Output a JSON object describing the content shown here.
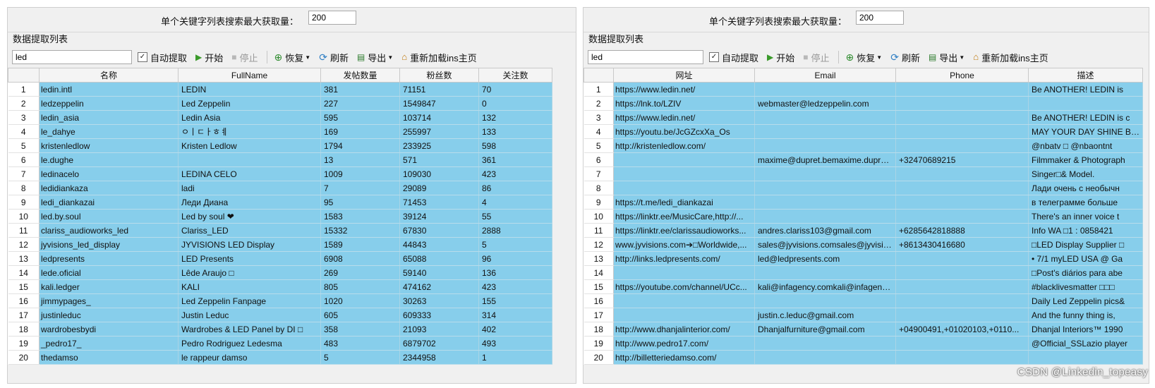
{
  "left": {
    "limit_label": "单个关键字列表搜索最大获取量：",
    "limit_value": "200",
    "section_title": "数据提取列表",
    "toolbar": {
      "keyword": "led",
      "auto_extract": "自动提取",
      "start": "开始",
      "stop": "停止",
      "restore": "恢复",
      "refresh": "刷新",
      "export": "导出",
      "reload": "重新加载ins主页"
    },
    "columns": [
      "名称",
      "FullName",
      "发帖数量",
      "粉丝数",
      "关注数"
    ],
    "rows": [
      [
        "1",
        "ledin.intl",
        "LEDIN",
        "381",
        "71151",
        "70"
      ],
      [
        "2",
        "ledzeppelin",
        "Led Zeppelin",
        "227",
        "1549847",
        "0"
      ],
      [
        "3",
        "ledin_asia",
        "Ledin Asia",
        "595",
        "103714",
        "132"
      ],
      [
        "4",
        "le_dahye",
        "ㅇㅣㄷㅏㅎㅖ",
        "169",
        "255997",
        "133"
      ],
      [
        "5",
        "kristenledlow",
        "Kristen Ledlow",
        "1794",
        "233925",
        "598"
      ],
      [
        "6",
        "le.dughe",
        "",
        "13",
        "571",
        "361"
      ],
      [
        "7",
        "ledinacelo",
        "LEDINA CELO",
        "1009",
        "109030",
        "423"
      ],
      [
        "8",
        "ledidiankaza",
        "ladi",
        "7",
        "29089",
        "86"
      ],
      [
        "9",
        "ledi_diankazai",
        "Леди Диана",
        "95",
        "71453",
        "4"
      ],
      [
        "10",
        "led.by.soul",
        "Led by soul ❤",
        "1583",
        "39124",
        "55"
      ],
      [
        "11",
        "clariss_audioworks_led",
        "Clariss_LED",
        "15332",
        "67830",
        "2888"
      ],
      [
        "12",
        "jyvisions_led_display",
        "JYVISIONS LED Display",
        "1589",
        "44843",
        "5"
      ],
      [
        "13",
        "ledpresents",
        "LED Presents",
        "6908",
        "65088",
        "96"
      ],
      [
        "14",
        "lede.oficial",
        "Lêde Araujo □",
        "269",
        "59140",
        "136"
      ],
      [
        "15",
        "kali.ledger",
        "KALI",
        "805",
        "474162",
        "423"
      ],
      [
        "16",
        "jimmypages_",
        "Led Zeppelin Fanpage",
        "1020",
        "30263",
        "155"
      ],
      [
        "17",
        "justinleduc",
        "Justin Leduc",
        "605",
        "609333",
        "314"
      ],
      [
        "18",
        "wardrobesbydi",
        "Wardrobes & LED Panel by DI □",
        "358",
        "21093",
        "402"
      ],
      [
        "19",
        "_pedro17_",
        "Pedro Rodriguez Ledesma",
        "483",
        "6879702",
        "493"
      ],
      [
        "20",
        "thedamso",
        "le rappeur damso",
        "5",
        "2344958",
        "1"
      ]
    ]
  },
  "right": {
    "limit_label": "单个关键字列表搜索最大获取量：",
    "limit_value": "200",
    "section_title": "数据提取列表",
    "toolbar": {
      "keyword": "led",
      "auto_extract": "自动提取",
      "start": "开始",
      "stop": "停止",
      "restore": "恢复",
      "refresh": "刷新",
      "export": "导出",
      "reload": "重新加载ins主页"
    },
    "columns": [
      "网址",
      "Email",
      "Phone",
      "描述"
    ],
    "rows": [
      [
        "1",
        "https://www.ledin.net/",
        "",
        "",
        "Be ANOTHER! LEDIN is"
      ],
      [
        "2",
        "https://lnk.to/LZIV",
        "webmaster@ledzeppelin.com",
        "",
        ""
      ],
      [
        "3",
        "https://www.ledin.net/",
        "",
        "",
        "Be ANOTHER! LEDIN is c"
      ],
      [
        "4",
        "https://youtu.be/JcGZcxXa_Os",
        "",
        "",
        "MAY YOUR DAY SHINE BRIG"
      ],
      [
        "5",
        "http://kristenledlow.com/",
        "",
        "",
        "@nbatv □ @nbaontnt"
      ],
      [
        "6",
        "",
        "maxime@dupret.bemaxime.dupret...",
        "+32470689215",
        "Filmmaker & Photograph"
      ],
      [
        "7",
        "",
        "",
        "",
        "Singer□& Model."
      ],
      [
        "8",
        "",
        "",
        "",
        "Лади очень с необычн"
      ],
      [
        "9",
        "https://t.me/ledi_diankazai",
        "",
        "",
        "в телеграмме больше"
      ],
      [
        "10",
        "https://linktr.ee/MusicCare,http://...",
        "",
        "",
        "There's an inner voice t"
      ],
      [
        "11",
        "https://linktr.ee/clarissaudioworks...",
        "andres.clariss103@gmail.com",
        "+6285642818888",
        "Info WA □1 : 0858421"
      ],
      [
        "12",
        "www.jyvisions.com➔□Worldwide,...",
        "sales@jyvisions.comsales@jyvisions....",
        "+8613430416680",
        "□LED Display Supplier □"
      ],
      [
        "13",
        "http://links.ledpresents.com/",
        "led@ledpresents.com",
        "",
        "• 7/1 myLED USA @ Ga"
      ],
      [
        "14",
        "",
        "",
        "",
        "□Post's diários para abe"
      ],
      [
        "15",
        "https://youtube.com/channel/UCc...",
        "kali@infagency.comkali@infagency....",
        "",
        "#blacklivesmatter □□□"
      ],
      [
        "16",
        "",
        "",
        "",
        "Daily Led Zeppelin pics&"
      ],
      [
        "17",
        "",
        "justin.c.leduc@gmail.com",
        "",
        "And the funny thing is,"
      ],
      [
        "18",
        "http://www.dhanjalinterior.com/",
        "Dhanjalfurniture@gmail.com",
        "+04900491,+01020103,+0110...",
        "Dhanjal Interiors™ 1990"
      ],
      [
        "19",
        "http://www.pedro17.com/",
        "",
        "",
        "@Official_SSLazio player"
      ],
      [
        "20",
        "http://billetteriedamso.com/",
        "",
        "",
        ""
      ]
    ]
  },
  "watermark": "CSDN @Linkedin_topeasy"
}
